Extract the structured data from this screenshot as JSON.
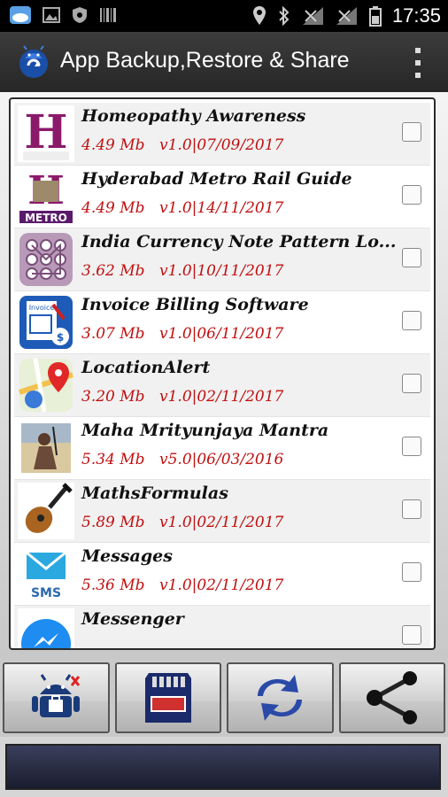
{
  "status_bar": {
    "time": "17:35",
    "icons": [
      "weather-icon",
      "image-icon",
      "shield-icon",
      "barcode-icon",
      "location-icon",
      "bluetooth-icon",
      "no-signal-icon",
      "no-signal-icon",
      "battery-icon"
    ]
  },
  "header": {
    "title": "App Backup,Restore & Share",
    "logo_icon": "android-app-icon",
    "menu_icon": "overflow-menu-icon"
  },
  "apps": [
    {
      "name": "Homeopathy Awareness",
      "size": "4.49 Mb",
      "version_date": "v1.0|07/09/2017",
      "icon": "homeopathy-icon",
      "checked": false
    },
    {
      "name": "Hyderabad Metro Rail Guide",
      "size": "4.49 Mb",
      "version_date": "v1.0|14/11/2017",
      "icon": "metro-icon",
      "checked": false
    },
    {
      "name": "India Currency Note Pattern Lo...",
      "size": "3.62 Mb",
      "version_date": "v1.0|10/11/2017",
      "icon": "pattern-lock-icon",
      "checked": false
    },
    {
      "name": "Invoice Billing Software",
      "size": "3.07 Mb",
      "version_date": "v1.0|06/11/2017",
      "icon": "invoice-icon",
      "checked": false
    },
    {
      "name": "LocationAlert",
      "size": "3.20 Mb",
      "version_date": "v1.0|02/11/2017",
      "icon": "map-pin-icon",
      "checked": false
    },
    {
      "name": "Maha Mrityunjaya Mantra",
      "size": "5.34 Mb",
      "version_date": "v5.0|06/03/2016",
      "icon": "shiva-icon",
      "checked": false
    },
    {
      "name": "MathsFormulas",
      "size": "5.89 Mb",
      "version_date": "v1.0|02/11/2017",
      "icon": "guitar-icon",
      "checked": false
    },
    {
      "name": "Messages",
      "size": "5.36 Mb",
      "version_date": "v1.0|02/11/2017",
      "icon": "sms-icon",
      "checked": false
    },
    {
      "name": "Messenger",
      "size": "",
      "version_date": "",
      "icon": "messenger-icon",
      "checked": false
    }
  ],
  "toolbar": {
    "buttons": [
      "android-backup-icon",
      "sd-card-icon",
      "sync-icon",
      "share-icon"
    ]
  }
}
